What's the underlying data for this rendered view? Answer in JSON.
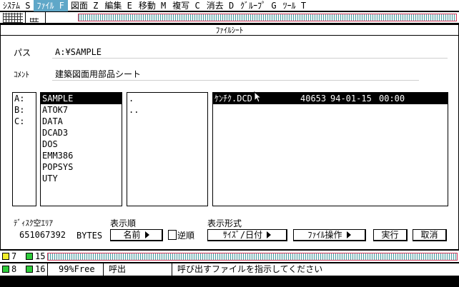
{
  "menubar": {
    "items": [
      {
        "label": "ｼｽﾃﾑ S",
        "active": false
      },
      {
        "label": "ﾌｧｲﾙ F",
        "active": true
      },
      {
        "label": "図面 Z",
        "active": false
      },
      {
        "label": "編集 E",
        "active": false
      },
      {
        "label": "移動 M",
        "active": false
      },
      {
        "label": "複写 C",
        "active": false
      },
      {
        "label": "消去 D",
        "active": false
      },
      {
        "label": "ｸﾞﾙｰﾌﾟ G",
        "active": false
      },
      {
        "label": "ﾂｰﾙ T",
        "active": false
      }
    ]
  },
  "dialog": {
    "title": "ﾌｧｲﾙｼｰﾄ",
    "path_label": "パス",
    "path_value": "A:¥SAMPLE",
    "comment_label": "ｺﾒﾝﾄ",
    "comment_value": "建築図面用部品シート",
    "drives": [
      "A:",
      "B:",
      "C:"
    ],
    "folders": [
      "SAMPLE",
      "ATOK7",
      "DATA",
      "DCAD3",
      "DOS",
      "EMM386",
      "POPSYS",
      "UTY"
    ],
    "parent_dirs": [
      ".",
      ".."
    ],
    "files": [
      {
        "name": "ｹﾝﾁｸ.DCD",
        "size": "40653",
        "date": "94-01-15",
        "time": "00:00"
      }
    ],
    "disk_free_label": "ﾃﾞｨｽｸ空ｴﾘｱ",
    "disk_free_value": "651067392",
    "disk_free_unit": "BYTES",
    "sort_label": "表示順",
    "sort_value": "名前",
    "reverse_label": "逆順",
    "format_label": "表示形式",
    "format_value": "ｻｲｽﾞ/日付",
    "file_ops_label": "ﾌｧｲﾙ操作",
    "execute_label": "実行",
    "cancel_label": "取消"
  },
  "statusbar": {
    "row1_value": "7",
    "row1_extra": "15",
    "row2_value": "8",
    "row2_extra": "16",
    "free_text": "99%Free",
    "mode_text": "呼出",
    "message": "呼び出すファイルを指示してください"
  },
  "colors": {
    "menu_active": "#5fa7c8",
    "yellow_indicator": "#f2ef2a",
    "green_indicator": "#2ecc3a",
    "dotted_border": "#d43a5c"
  }
}
